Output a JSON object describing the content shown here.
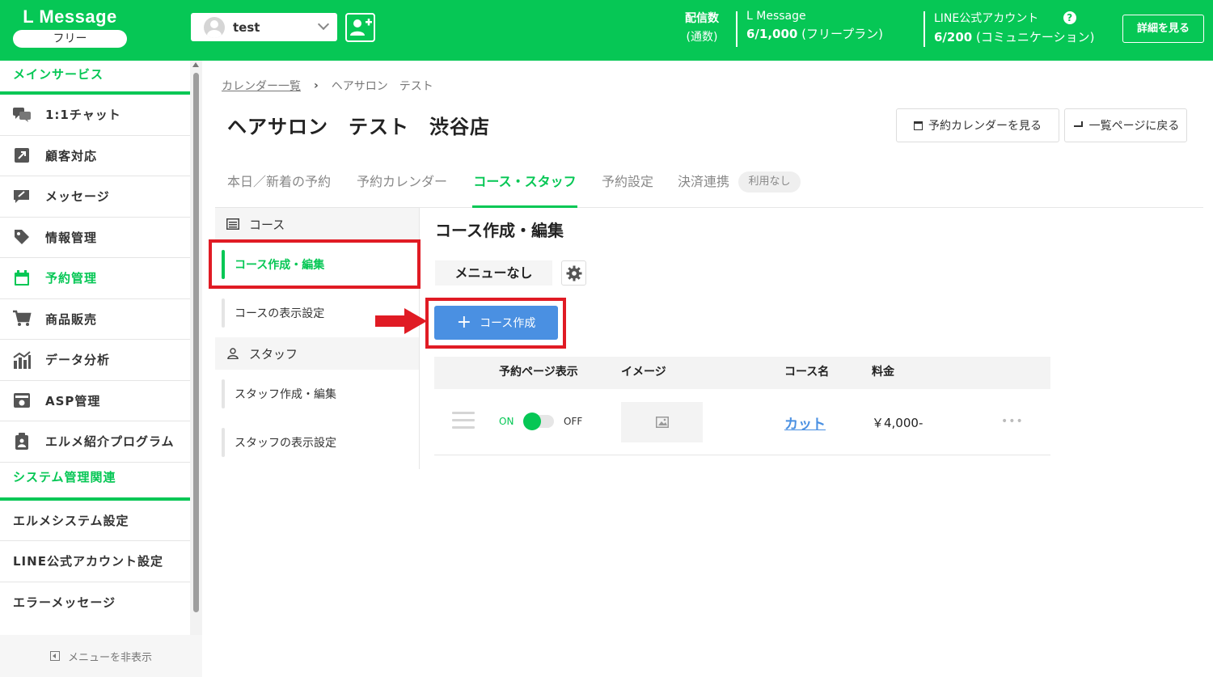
{
  "header": {
    "app_name": "L Message",
    "plan_badge": "フリー",
    "account_name": "test",
    "delivery_label": "配信数",
    "delivery_sub": "(通数)",
    "lmessage_label": "L Message",
    "lmessage_count": "6/1,000",
    "lmessage_plan": "(フリープラン)",
    "line_label": "LINE公式アカウント",
    "line_count": "6/200",
    "line_plan": "(コミュニケーション)",
    "help_glyph": "?",
    "details_button": "詳細を見る"
  },
  "sidebar": {
    "main_section": "メインサービス",
    "items": [
      {
        "label": "1:1チャット",
        "icon": "chat-icon"
      },
      {
        "label": "顧客対応",
        "icon": "external-link-icon"
      },
      {
        "label": "メッセージ",
        "icon": "message-edit-icon"
      },
      {
        "label": "情報管理",
        "icon": "tag-icon"
      },
      {
        "label": "予約管理",
        "icon": "calendar-icon"
      },
      {
        "label": "商品販売",
        "icon": "cart-icon"
      },
      {
        "label": "データ分析",
        "icon": "chart-icon"
      },
      {
        "label": "ASP管理",
        "icon": "asp-icon"
      },
      {
        "label": "エルメ紹介プログラム",
        "icon": "clipboard-icon"
      }
    ],
    "system_section": "システム管理関連",
    "system_items": [
      "エルメシステム設定",
      "LINE公式アカウント設定",
      "エラーメッセージ"
    ],
    "footer": "メニューを非表示"
  },
  "breadcrumb": {
    "parent": "カレンダー一覧",
    "separator": "›",
    "current": "ヘアサロン　テスト"
  },
  "page_title": "ヘアサロン　テスト　渋谷店",
  "buttons": {
    "view_calendar": "予約カレンダーを見る",
    "back_to_list": "一覧ページに戻る"
  },
  "tabs": [
    "本日／新着の予約",
    "予約カレンダー",
    "コース・スタッフ",
    "予約設定",
    "決済連携"
  ],
  "tab_badge": "利用なし",
  "subnav": {
    "course_group": "コース",
    "course_items": [
      "コース作成・編集",
      "コースの表示設定"
    ],
    "staff_group": "スタッフ",
    "staff_items": [
      "スタッフ作成・編集",
      "スタッフの表示設定"
    ]
  },
  "content": {
    "section_title": "コース作成・編集",
    "menu_chip": "メニューなし",
    "create_button": "コース作成",
    "create_button_plus": "+"
  },
  "table": {
    "headers": [
      "予約ページ表示",
      "イメージ",
      "コース名",
      "料金"
    ],
    "rows": [
      {
        "on_label": "ON",
        "off_label": "OFF",
        "course_name": "カット",
        "price": "￥4,000-",
        "more": "•••"
      }
    ]
  },
  "colors": {
    "brand": "#06c755",
    "primary_button": "#4a90e2",
    "highlight": "#e01b24"
  }
}
